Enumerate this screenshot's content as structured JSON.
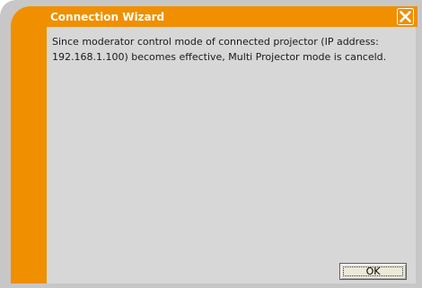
{
  "window": {
    "title": "Connection Wizard",
    "close_icon": "close-x-icon",
    "accent_color": "#f08f00",
    "frame_color": "#c7c7c7",
    "panel_color": "#d7d7d7"
  },
  "message": {
    "text": "Since moderator control mode of connected projector (IP address: 192.168.1.100) becomes effective, Multi Projector mode is canceld."
  },
  "buttons": {
    "ok_label": "OK"
  }
}
